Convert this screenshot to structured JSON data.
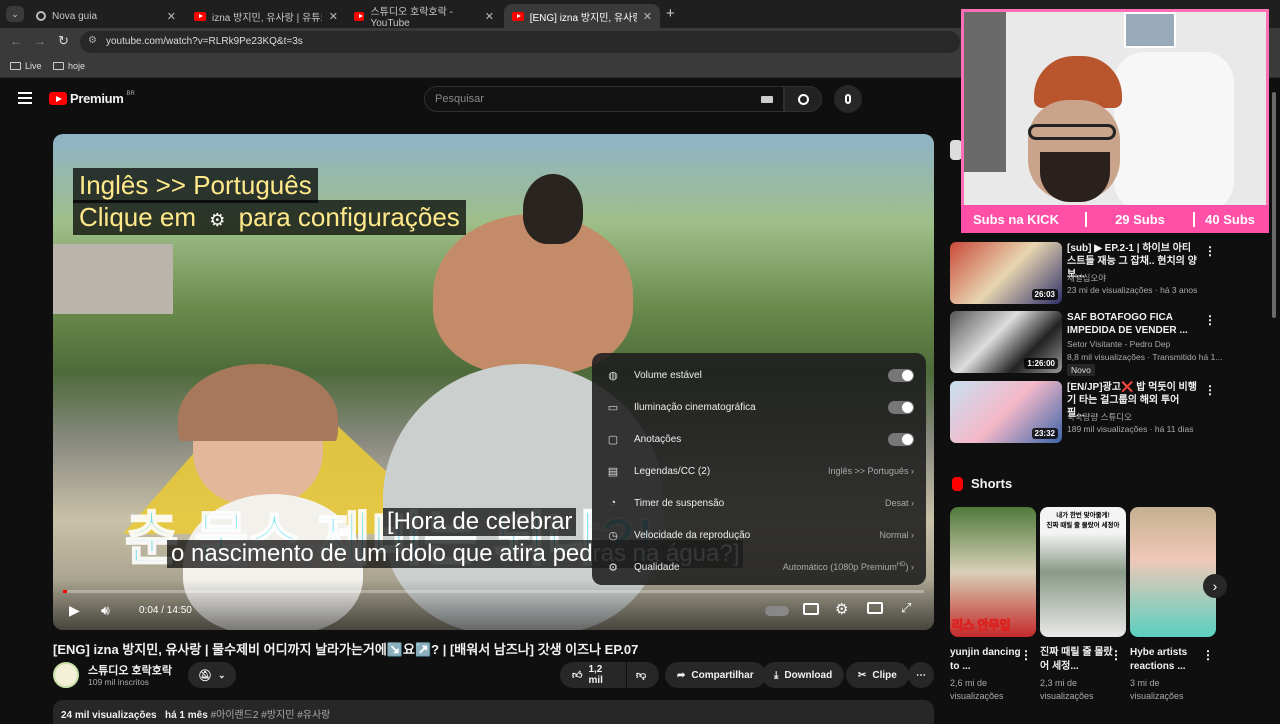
{
  "browser": {
    "tabs": [
      {
        "label": "Nova guia"
      },
      {
        "label": "izna 방지민, 유사랑 | 유튜브 하"
      },
      {
        "label": "스튜디오 호락호락 - YouTube"
      },
      {
        "label": "[ENG] izna 방지민, 유사랑 | 물수"
      }
    ],
    "new_tab": "+",
    "url": "youtube.com/watch?v=RLRk9Pe23KQ&t=3s",
    "bookmarks": [
      {
        "label": "Live"
      },
      {
        "label": "hoje"
      }
    ]
  },
  "header": {
    "logo_text": "Premium",
    "logo_region": "BR",
    "search_placeholder": "Pesquisar"
  },
  "player": {
    "overlay_line1": "Inglês >> Português",
    "overlay_line2a": "Clique em",
    "overlay_line2b": "para configurações",
    "big_korean": "춘 묻스 제비는 되냐?!",
    "subtitle_line1": "[Hora de celebrar",
    "subtitle_line2": "o nascimento de um ídolo que atira pedras na água?]",
    "time": "0:04 / 14:50",
    "progress_fraction": 0.0045,
    "settings_menu": [
      {
        "label": "Volume estável",
        "type": "toggle",
        "icon": "volume-stable-icon"
      },
      {
        "label": "Iluminação cinematográfica",
        "type": "toggle",
        "icon": "ambient-mode-icon"
      },
      {
        "label": "Anotações",
        "type": "toggle",
        "icon": "annotations-icon"
      },
      {
        "label": "Legendas/CC (2)",
        "value": "Inglês >> Português",
        "icon": "captions-icon"
      },
      {
        "label": "Timer de suspensão",
        "value": "Desat",
        "icon": "sleep-timer-icon"
      },
      {
        "label": "Velocidade da reprodução",
        "value": "Normal",
        "icon": "speed-icon"
      },
      {
        "label": "Qualidade",
        "value": "Automático (1080p Premium",
        "value_sup": "HD",
        "icon": "quality-icon"
      }
    ]
  },
  "video": {
    "title": "[ENG] izna 방지민, 유사랑 | 물수제비 어디까지 날라가는거에↘️요↗️? | [배워서 남즈나] 갓생 이즈나 EP.07",
    "channel": "스튜디오 호락호락",
    "subscribers": "109 mil inscritos",
    "likes": "1,2 mil",
    "share": "Compartilhar",
    "download": "Download",
    "clip": "Clipe",
    "views": "24 mil visualizações",
    "posted": "há 1 mês",
    "hashtags": "#아이랜드2 #방지민 #유사랑"
  },
  "sidebar": {
    "recommendations": [
      {
        "title": "[sub] ▶ EP.2-1 | 하이브 아티스트들 재능 그 잡채.. 현치의 양보...",
        "channel": "채널십오야",
        "meta": "23 mi de visualizações · há 3 anos",
        "duration": "26:03"
      },
      {
        "title": "SAF BOTAFOGO FICA IMPEDIDA DE VENDER ...",
        "channel": "Setor Visitante - Pedro Dep",
        "meta": "8,8 mil visualizações · Transmitido há 1...",
        "badge": "Novo",
        "duration": "1:26:00"
      },
      {
        "title": "[EN/JP]광고❌ 밥 먹듯이 비행기 타는 걸그룹의 해외 투어 필...",
        "channel": "숙숙량량 스튜디오",
        "meta": "189 mil visualizações · há 11 dias",
        "duration": "23:32"
      }
    ],
    "shorts_title": "Shorts",
    "shorts": [
      {
        "title": "yunjin dancing to ...",
        "meta": "2,6 mi de visualizações",
        "caption": "리스 안무입"
      },
      {
        "title": "진짜 때릴 줄 몰랐어 세정...",
        "meta": "2,3 mi de visualizações",
        "caption": "내가 한번 맞아줄게!\n진짜 때릴 줄 몰랐어 세정아"
      },
      {
        "title": "Hybe artists reactions ...",
        "meta": "3 mi de visualizações",
        "caption": ""
      }
    ]
  },
  "webcam": {
    "subs_label": "Subs na KICK",
    "subs_count": "29 Subs",
    "subs_goal": "40 Subs"
  },
  "colors": {
    "accent": "#ff0000",
    "overlay_pink": "#ff4fa7",
    "caption_yellow": "#ffe98a"
  }
}
